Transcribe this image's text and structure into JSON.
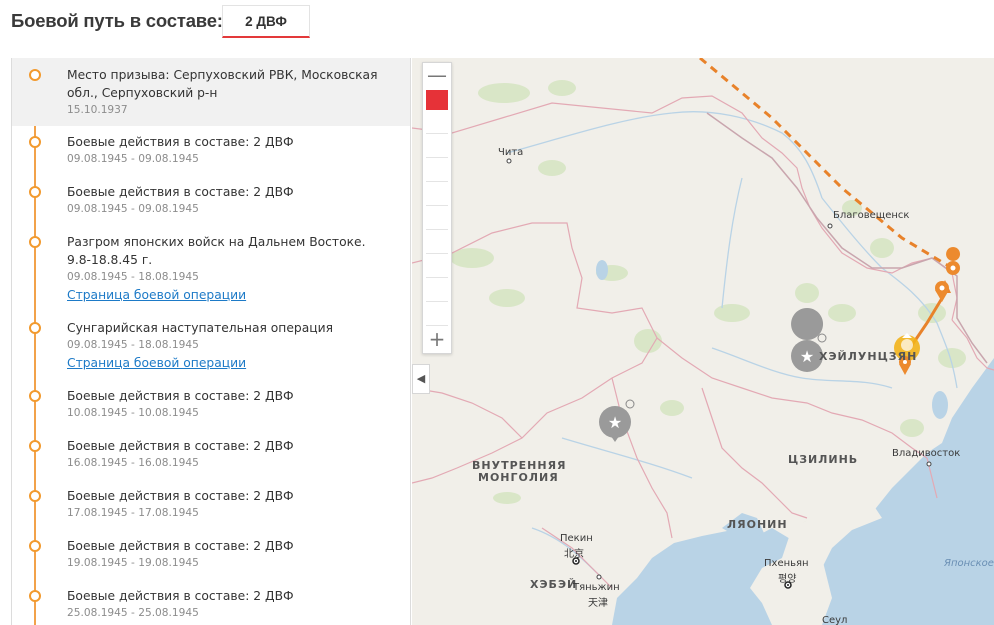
{
  "header": {
    "title": "Боевой путь в составе:",
    "unit_badge": "2 ДВФ"
  },
  "timeline": {
    "events": [
      {
        "title": "Место призыва: Серпуховский РВК, Московская обл., Серпуховский р-н",
        "date": "15.10.1937",
        "link": ""
      },
      {
        "title": "Боевые действия в составе: 2 ДВФ",
        "date": "09.08.1945 - 09.08.1945",
        "link": ""
      },
      {
        "title": "Боевые действия в составе: 2 ДВФ",
        "date": "09.08.1945 - 09.08.1945",
        "link": ""
      },
      {
        "title": "Разгром японских войск на Дальнем Востоке. 9.8-18.8.45 г.",
        "date": "09.08.1945 - 18.08.1945",
        "link": "Страница боевой операции"
      },
      {
        "title": "Сунгарийская наступательная операция",
        "date": "09.08.1945 - 18.08.1945",
        "link": "Страница боевой операции"
      },
      {
        "title": "Боевые действия в составе: 2 ДВФ",
        "date": "10.08.1945 - 10.08.1945",
        "link": ""
      },
      {
        "title": "Боевые действия в составе: 2 ДВФ",
        "date": "16.08.1945 - 16.08.1945",
        "link": ""
      },
      {
        "title": "Боевые действия в составе: 2 ДВФ",
        "date": "17.08.1945 - 17.08.1945",
        "link": ""
      },
      {
        "title": "Боевые действия в составе: 2 ДВФ",
        "date": "19.08.1945 - 19.08.1945",
        "link": ""
      },
      {
        "title": "Боевые действия в составе: 2 ДВФ",
        "date": "25.08.1945 - 25.08.1945",
        "link": ""
      }
    ]
  },
  "map": {
    "zoom_in": "+",
    "zoom_out": "—",
    "collapse": "◀",
    "labels": {
      "chita": "Чита",
      "blagoveshchensk": "Благовещенск",
      "heilongjiang": "ХЭЙЛУНЦЗЯН",
      "inner_mongolia_1": "ВНУТРЕННЯЯ",
      "inner_mongolia_2": "МОНГОЛИЯ",
      "jilin": "ЦЗИЛИНЬ",
      "vladivostok": "Владивосток",
      "liaoning": "ЛЯОНИН",
      "beijing": "Пекин",
      "beijing_native": "北京",
      "hebei": "ХЭБЭЙ",
      "tianjin": "Тяньжин",
      "tianjin_native": "天津",
      "pyongyang": "Пхеньян",
      "pyongyang_native": "평양",
      "seoul": "Сеул",
      "sea_of_japan": "Японское"
    },
    "colors": {
      "route": "#e8822a",
      "marker_orange": "#ec8a2e",
      "marker_gold": "#f2b21b",
      "marker_grey": "#9a9a9a",
      "water": "#b9d3e6",
      "land": "#f1efe9",
      "green": "#d8e6c8",
      "border": "#dfa6b0"
    }
  }
}
